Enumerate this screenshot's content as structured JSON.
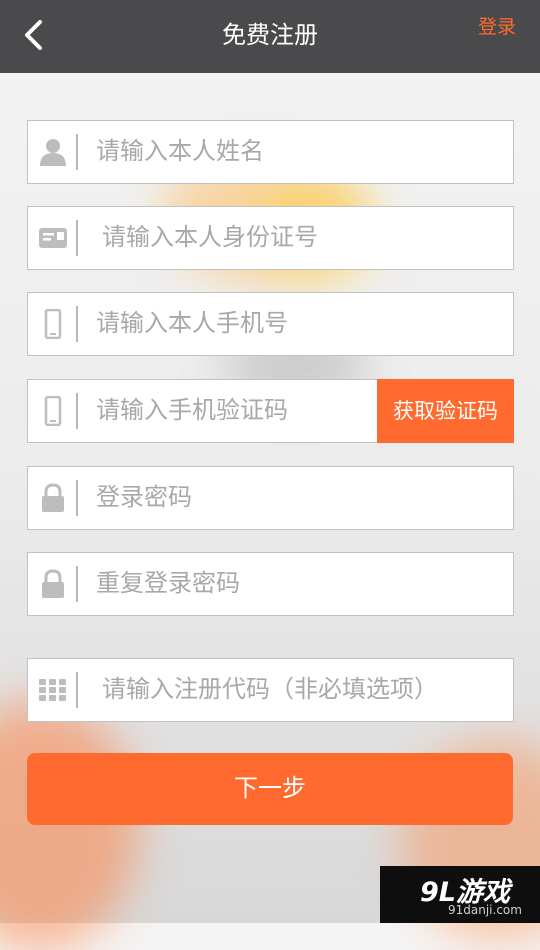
{
  "header": {
    "title": "免费注册",
    "login_label": "登录"
  },
  "form": {
    "fields": [
      {
        "placeholder": "请输入本人姓名",
        "icon": "person-icon"
      },
      {
        "placeholder": "请输入本人身份证号",
        "icon": "id-card-icon"
      },
      {
        "placeholder": "请输入本人手机号",
        "icon": "phone-icon"
      },
      {
        "placeholder": "请输入手机验证码",
        "icon": "phone-icon"
      },
      {
        "placeholder": "登录密码",
        "icon": "lock-icon"
      },
      {
        "placeholder": "重复登录密码",
        "icon": "lock-icon"
      },
      {
        "placeholder": "请输入注册代码（非必填选项）",
        "icon": "keypad-icon"
      }
    ],
    "get_code_label": "获取验证码",
    "next_label": "下一步"
  },
  "watermark": {
    "logo_text": "9L游戏",
    "url": "91danji.com"
  },
  "colors": {
    "accent": "#ff6a2e",
    "header_bg": "#4a4a4c"
  }
}
